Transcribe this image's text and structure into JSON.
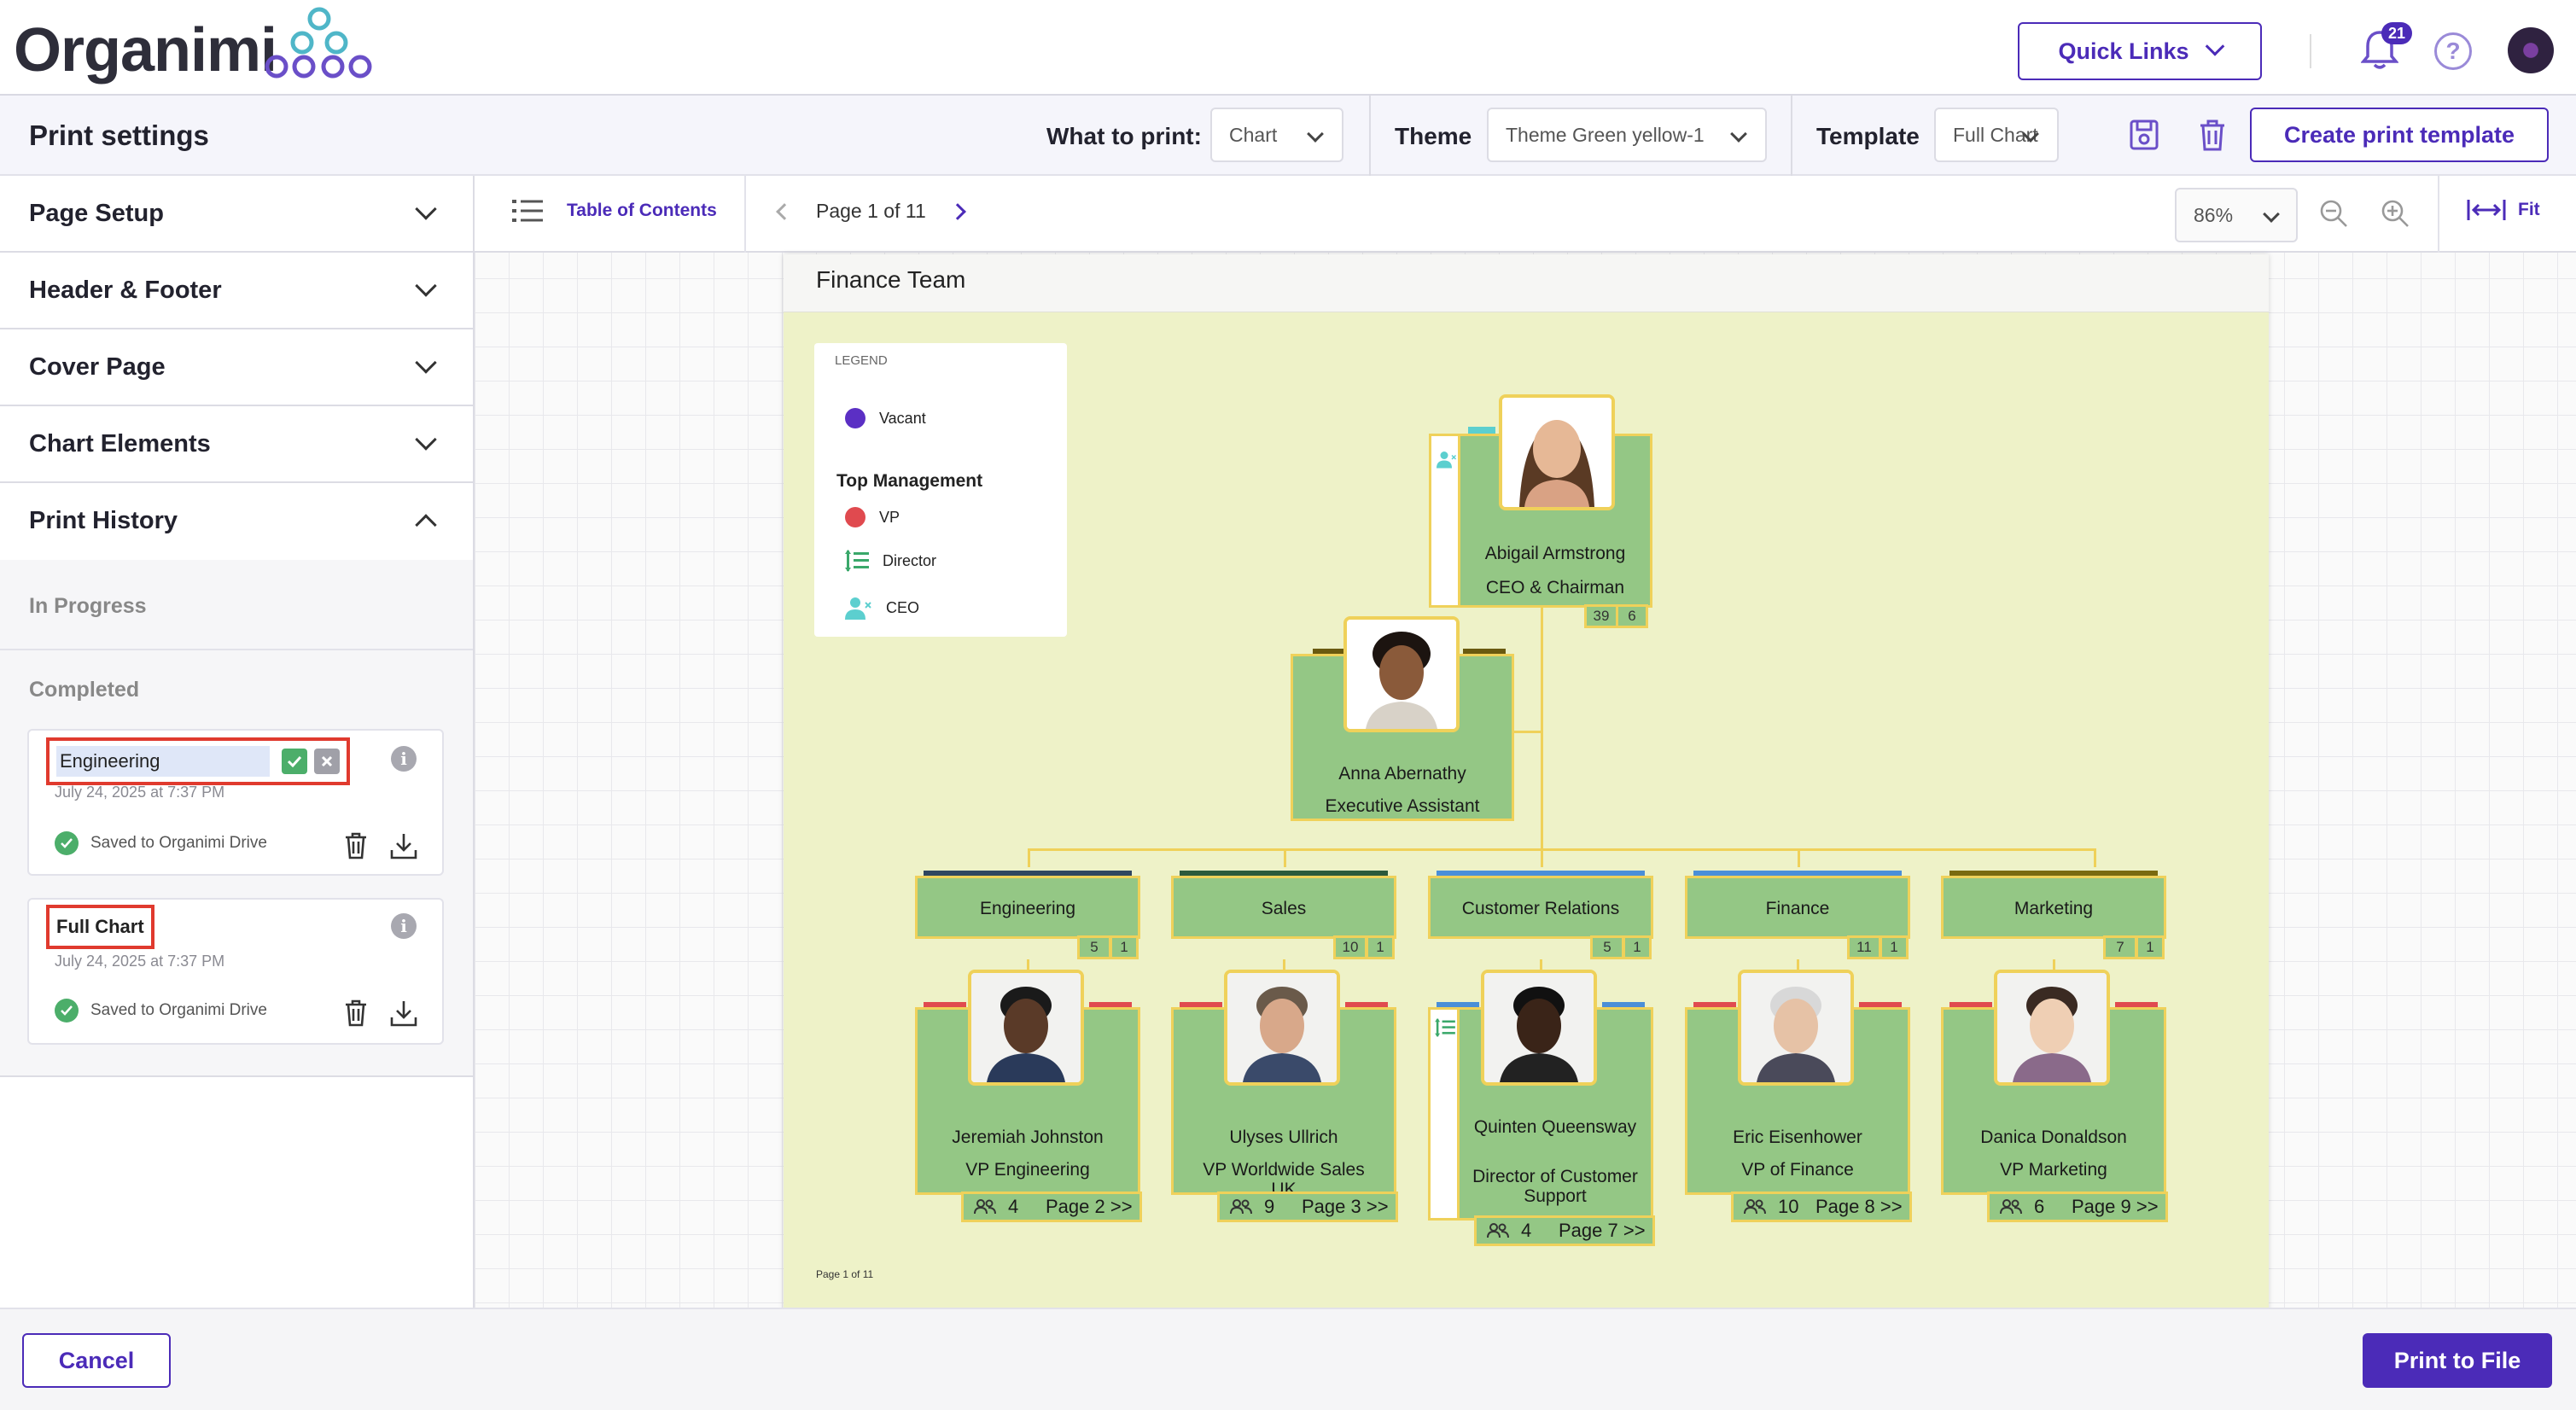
{
  "app": {
    "logo_text": "Organimi",
    "quick_links_label": "Quick Links",
    "notifications_count": "21",
    "help_label": "?"
  },
  "print_bar": {
    "title": "Print settings",
    "what_to_print_label": "What to print:",
    "what_to_print_value": "Chart",
    "theme_label": "Theme",
    "theme_value": "Theme Green yellow-1",
    "template_label": "Template",
    "template_value": "Full Chart",
    "create_template_label": "Create print template"
  },
  "sidebar": {
    "sections": [
      {
        "label": "Page Setup"
      },
      {
        "label": "Header & Footer"
      },
      {
        "label": "Cover Page"
      },
      {
        "label": "Chart Elements"
      },
      {
        "label": "Print History"
      }
    ],
    "in_progress_label": "In Progress",
    "completed_label": "Completed",
    "history": [
      {
        "name": "Engineering",
        "date": "July 24, 2025 at 7:37 PM",
        "status": "Saved to Organimi Drive",
        "editing": true
      },
      {
        "name": "Full Chart",
        "date": "July 24, 2025 at 7:37 PM",
        "status": "Saved to Organimi Drive",
        "editing": false
      }
    ]
  },
  "preview_toolbar": {
    "toc_label": "Table of Contents",
    "page_indicator": "Page 1 of 11",
    "zoom_value": "86%",
    "fit_label": "Fit"
  },
  "page": {
    "title": "Finance Team",
    "footer": "Page 1 of 11",
    "legend": {
      "title": "LEGEND",
      "vacant_label": "Vacant",
      "group_label": "Top Management",
      "vp_label": "VP",
      "director_label": "Director",
      "ceo_label": "CEO",
      "colors": {
        "vacant": "#5b2fc4",
        "vp": "#e04a4f",
        "director": "#3aa86a",
        "ceo": "#5ccfcf"
      }
    },
    "chart": {
      "ceo": {
        "name": "Abigail Armstrong",
        "role": "CEO & Chairman",
        "count_a": "39",
        "count_b": "6"
      },
      "assistant": {
        "name": "Anna Abernathy",
        "role": "Executive Assistant"
      },
      "departments": [
        {
          "name": "Engineering",
          "count_a": "5",
          "count_b": "1",
          "bar": "#2f4660"
        },
        {
          "name": "Sales",
          "count_a": "10",
          "count_b": "1",
          "bar": "#2c5a3c"
        },
        {
          "name": "Customer Relations",
          "count_a": "5",
          "count_b": "1",
          "bar": "#4a8fd8"
        },
        {
          "name": "Finance",
          "count_a": "11",
          "count_b": "1",
          "bar": "#4a8fd8"
        },
        {
          "name": "Marketing",
          "count_a": "7",
          "count_b": "1",
          "bar": "#7a6a10"
        }
      ],
      "vps": [
        {
          "name": "Jeremiah Johnston",
          "role": "VP Engineering",
          "reports": "4",
          "page": "Page 2 >>"
        },
        {
          "name": "Ulyses Ullrich",
          "role": "VP Worldwide Sales UK",
          "reports": "9",
          "page": "Page 3 >>"
        },
        {
          "name": "Quinten Queensway",
          "role": "Director of Customer Support",
          "reports": "4",
          "page": "Page 7 >>"
        },
        {
          "name": "Eric Eisenhower",
          "role": "VP of Finance",
          "reports": "10",
          "page": "Page 8 >>"
        },
        {
          "name": "Danica Donaldson",
          "role": "VP Marketing",
          "reports": "6",
          "page": "Page 9 >>"
        }
      ]
    }
  },
  "footer": {
    "cancel_label": "Cancel",
    "print_label": "Print to File"
  }
}
